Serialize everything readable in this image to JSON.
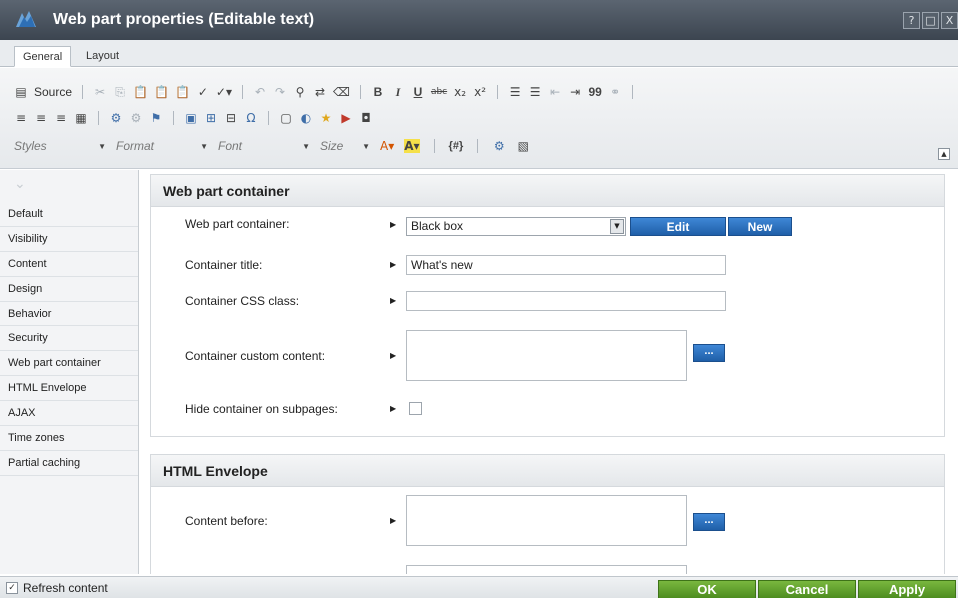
{
  "window": {
    "title": "Web part properties (Editable text)",
    "logo_icon": "kentico-logo-icon",
    "buttons": {
      "help": "?",
      "maximize": "□",
      "close": "X"
    }
  },
  "tabs": [
    {
      "label": "General",
      "active": true
    },
    {
      "label": "Layout",
      "active": false
    }
  ],
  "toolbar": {
    "source_label": "Source",
    "row1_icons": [
      "cut-icon",
      "copy-icon",
      "paste-icon",
      "paste-text-icon",
      "paste-word-icon",
      "spellcheck-icon",
      "spellcheck-as-you-type-icon",
      "undo-icon",
      "redo-icon",
      "find-icon",
      "replace-icon",
      "remove-format-icon",
      "bold-icon",
      "italic-icon",
      "underline-icon",
      "strikethrough-icon",
      "subscript-icon",
      "superscript-icon",
      "numbered-list-icon",
      "bulleted-list-icon",
      "outdent-icon",
      "indent-icon",
      "blockquote-icon",
      "link-icon"
    ],
    "row1_glyphs": {
      "bold": "B",
      "italic": "I",
      "underline": "U",
      "strike": "abc",
      "sub": "x₂",
      "sup": "x²",
      "quote": "99"
    },
    "styles_label": "Styles",
    "format_label": "Format",
    "font_label": "Font",
    "size_label": "Size",
    "macro_label": "{#}",
    "collapse_glyph": "▲"
  },
  "sidebar": {
    "items": [
      {
        "label": "Default"
      },
      {
        "label": "Visibility"
      },
      {
        "label": "Content"
      },
      {
        "label": "Design"
      },
      {
        "label": "Behavior"
      },
      {
        "label": "Security"
      },
      {
        "label": "Web part container"
      },
      {
        "label": "HTML Envelope"
      },
      {
        "label": "AJAX"
      },
      {
        "label": "Time zones"
      },
      {
        "label": "Partial caching"
      }
    ]
  },
  "sections": {
    "container": {
      "title": "Web part container",
      "fields": {
        "container_label": "Web part container:",
        "container_value": "Black box",
        "edit_label": "Edit",
        "new_label": "New",
        "title_label": "Container title:",
        "title_value": "What's new",
        "css_label": "Container CSS class:",
        "css_value": "",
        "custom_label": "Container custom content:",
        "custom_value": "",
        "hide_label": "Hide container on subpages:",
        "hide_checked": false,
        "dots_label": "..."
      }
    },
    "envelope": {
      "title": "HTML Envelope",
      "fields": {
        "before_label": "Content before:",
        "before_value": "",
        "dots_label": "..."
      }
    }
  },
  "footer": {
    "refresh_label": "Refresh content",
    "refresh_checked": true,
    "ok_label": "OK",
    "cancel_label": "Cancel",
    "apply_label": "Apply"
  }
}
